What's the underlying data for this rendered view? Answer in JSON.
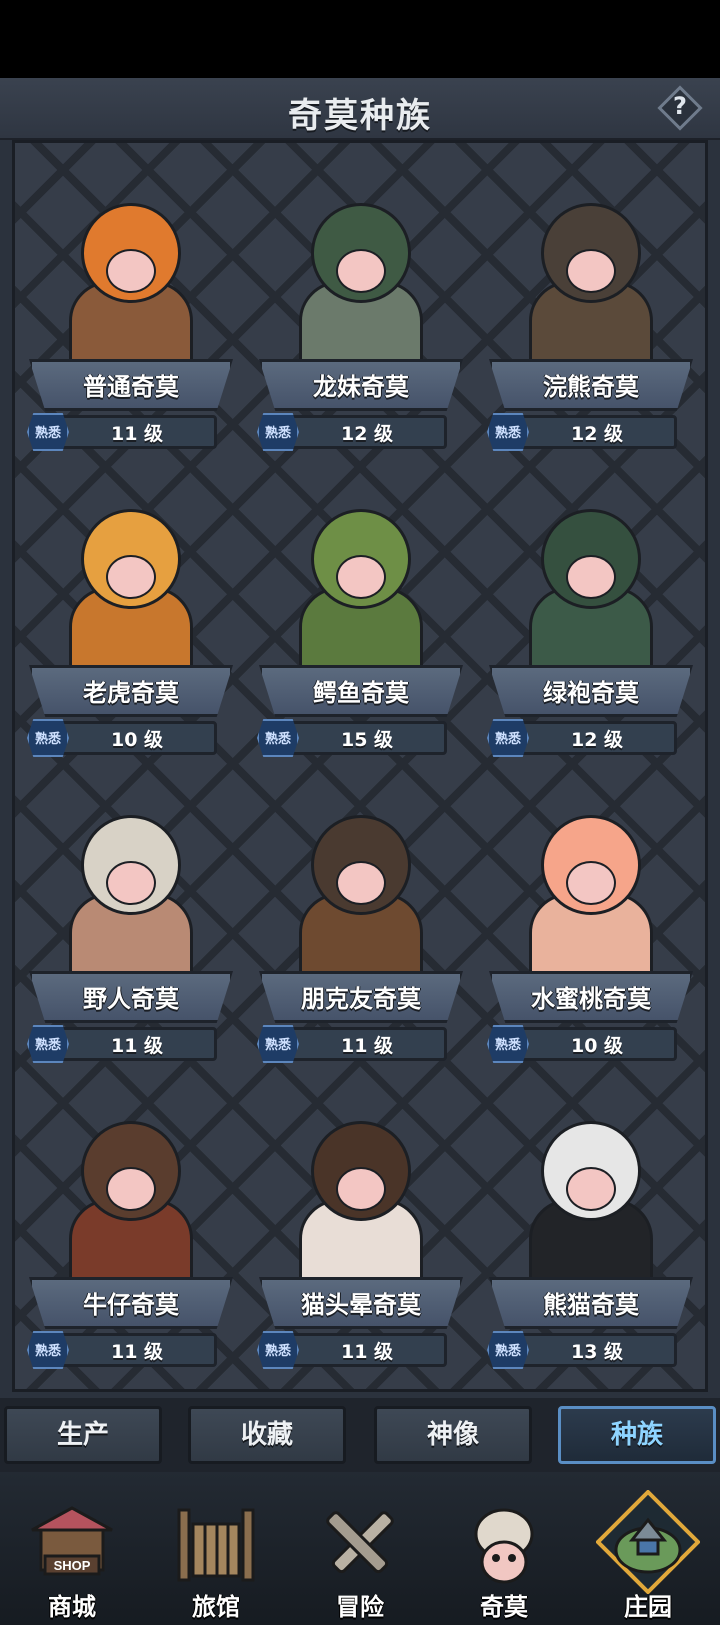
{
  "header": {
    "title": "奇莫种族",
    "help_glyph": "?"
  },
  "badge_label": "熟悉",
  "races": [
    {
      "name": "普通奇莫",
      "level": "11 级",
      "skin": "#8a5a3a",
      "head": "#e07a2e"
    },
    {
      "name": "龙妹奇莫",
      "level": "12 级",
      "skin": "#6b7a6b",
      "head": "#3f5a44"
    },
    {
      "name": "浣熊奇莫",
      "level": "12 级",
      "skin": "#5b4a3a",
      "head": "#4a4038"
    },
    {
      "name": "老虎奇莫",
      "level": "10 级",
      "skin": "#c8772d",
      "head": "#e6a040"
    },
    {
      "name": "鳄鱼奇莫",
      "level": "15 级",
      "skin": "#5b7a3e",
      "head": "#6e8f46"
    },
    {
      "name": "绿袍奇莫",
      "level": "12 级",
      "skin": "#3c5a48",
      "head": "#35503f"
    },
    {
      "name": "野人奇莫",
      "level": "11 级",
      "skin": "#b98a74",
      "head": "#d8d2c6"
    },
    {
      "name": "朋克友奇莫",
      "level": "11 级",
      "skin": "#6e4a30",
      "head": "#4a3a30"
    },
    {
      "name": "水蜜桃奇莫",
      "level": "10 级",
      "skin": "#e9b29c",
      "head": "#f6a58a"
    },
    {
      "name": "牛仔奇莫",
      "level": "11 级",
      "skin": "#7a3b2a",
      "head": "#5a3d2e"
    },
    {
      "name": "猫头晕奇莫",
      "level": "11 级",
      "skin": "#e8ddd6",
      "head": "#4a3428"
    },
    {
      "name": "熊猫奇莫",
      "level": "13 级",
      "skin": "#222428",
      "head": "#e6e6e6"
    }
  ],
  "sub_tabs": [
    {
      "label": "生产",
      "active": false
    },
    {
      "label": "收藏",
      "active": false
    },
    {
      "label": "神像",
      "active": false
    },
    {
      "label": "种族",
      "active": true
    }
  ],
  "nav": [
    {
      "label": "商城",
      "icon": "shop-icon",
      "color": "#b5535e",
      "sign": "SHOP"
    },
    {
      "label": "旅馆",
      "icon": "inn-gate-icon",
      "color": "#8a6e4e",
      "sign": ""
    },
    {
      "label": "冒险",
      "icon": "crossed-swords-icon",
      "color": "#b9b1a3",
      "sign": ""
    },
    {
      "label": "奇莫",
      "icon": "qimo-character-icon",
      "color": "#e0d8cc",
      "sign": ""
    },
    {
      "label": "庄园",
      "icon": "manor-island-icon",
      "color": "#6a9a5a",
      "sign": ""
    }
  ]
}
